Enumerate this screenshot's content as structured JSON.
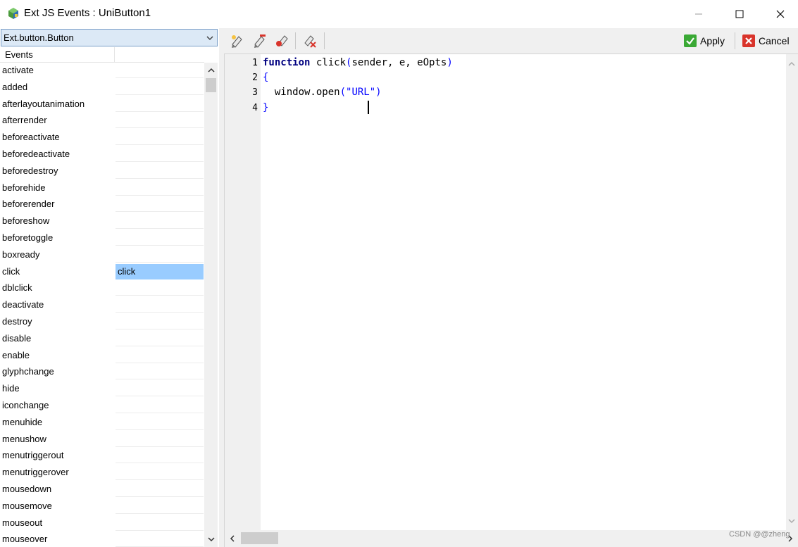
{
  "window": {
    "title": "Ext JS Events : UniButton1"
  },
  "left_panel": {
    "class_selector": "Ext.button.Button",
    "events_header": "Events",
    "events": [
      {
        "name": "activate",
        "handler": ""
      },
      {
        "name": "added",
        "handler": ""
      },
      {
        "name": "afterlayoutanimation",
        "handler": ""
      },
      {
        "name": "afterrender",
        "handler": ""
      },
      {
        "name": "beforeactivate",
        "handler": ""
      },
      {
        "name": "beforedeactivate",
        "handler": ""
      },
      {
        "name": "beforedestroy",
        "handler": ""
      },
      {
        "name": "beforehide",
        "handler": ""
      },
      {
        "name": "beforerender",
        "handler": ""
      },
      {
        "name": "beforeshow",
        "handler": ""
      },
      {
        "name": "beforetoggle",
        "handler": ""
      },
      {
        "name": "boxready",
        "handler": ""
      },
      {
        "name": "click",
        "handler": "click"
      },
      {
        "name": "dblclick",
        "handler": ""
      },
      {
        "name": "deactivate",
        "handler": ""
      },
      {
        "name": "destroy",
        "handler": ""
      },
      {
        "name": "disable",
        "handler": ""
      },
      {
        "name": "enable",
        "handler": ""
      },
      {
        "name": "glyphchange",
        "handler": ""
      },
      {
        "name": "hide",
        "handler": ""
      },
      {
        "name": "iconchange",
        "handler": ""
      },
      {
        "name": "menuhide",
        "handler": ""
      },
      {
        "name": "menushow",
        "handler": ""
      },
      {
        "name": "menutriggerout",
        "handler": ""
      },
      {
        "name": "menutriggerover",
        "handler": ""
      },
      {
        "name": "mousedown",
        "handler": ""
      },
      {
        "name": "mousemove",
        "handler": ""
      },
      {
        "name": "mouseout",
        "handler": ""
      },
      {
        "name": "mouseover",
        "handler": ""
      }
    ]
  },
  "toolbar": {
    "icons": [
      "add-handler-icon",
      "edit-handler-icon",
      "delete-handler-icon",
      "clear-handler-icon"
    ],
    "apply_label": "Apply",
    "cancel_label": "Cancel"
  },
  "editor": {
    "line_numbers": [
      "1",
      "2",
      "3",
      "4"
    ],
    "code": {
      "line1_kw": "function",
      "line1_name": " click",
      "line1_open": "(",
      "line1_params": "sender, e, eOpts",
      "line1_close": ")",
      "line2": "{",
      "line3_call": "  window.open",
      "line3_open": "(",
      "line3_str": "\"URL\"",
      "line3_close": ")",
      "line4": "}"
    }
  },
  "watermark": "CSDN @@zheng",
  "colors": {
    "selected_row": "#99ccff",
    "keyword": "#000080",
    "punctuation": "#0000ff",
    "apply_green": "#3aa935",
    "cancel_red": "#d9342b"
  }
}
